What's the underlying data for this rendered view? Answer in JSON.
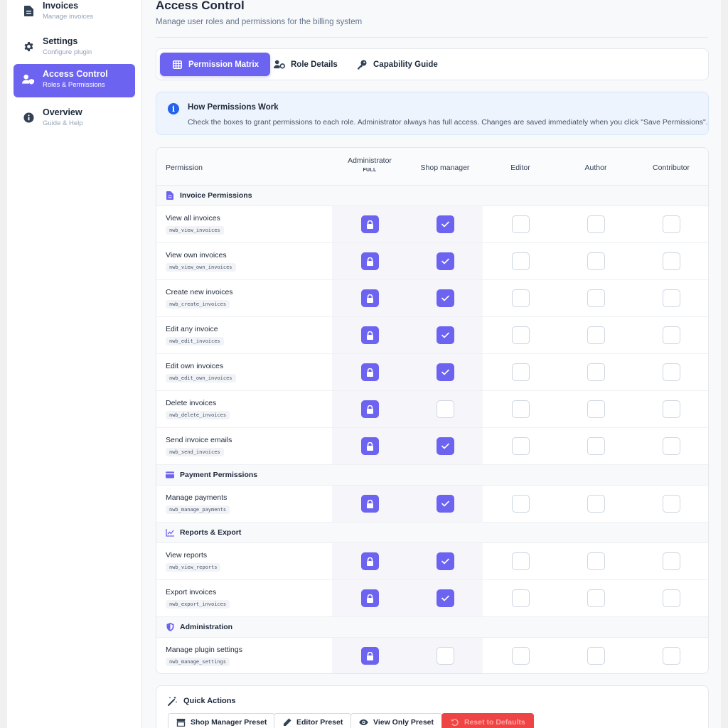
{
  "sidebar": {
    "items": [
      {
        "title": "Invoices",
        "sub": "Manage invoices",
        "icon": "document-icon"
      },
      {
        "title": "Settings",
        "sub": "Configure plugin",
        "icon": "gear-icon"
      },
      {
        "title": "Access Control",
        "sub": "Roles & Permissions",
        "icon": "user-shield-icon",
        "active": true
      },
      {
        "title": "Overview",
        "sub": "Guide & Help",
        "icon": "info-icon"
      }
    ]
  },
  "page": {
    "title": "Access Control",
    "subtitle": "Manage user roles and permissions for the billing system"
  },
  "tabs": [
    {
      "label": "Permission Matrix",
      "icon": "table-icon",
      "active": true
    },
    {
      "label": "Role Details",
      "icon": "user-gear-icon"
    },
    {
      "label": "Capability Guide",
      "icon": "key-icon"
    }
  ],
  "info": {
    "title": "How Permissions Work",
    "text": "Check the boxes to grant permissions to each role. Administrator always has full access. Changes are saved immediately when you click \"Save Permissions\"."
  },
  "matrix": {
    "permission_header": "Permission",
    "roles": [
      {
        "name": "Administrator",
        "tag": "FULL"
      },
      {
        "name": "Shop manager"
      },
      {
        "name": "Editor"
      },
      {
        "name": "Author"
      },
      {
        "name": "Contributor"
      }
    ],
    "sections": [
      {
        "label": "Invoice Permissions",
        "icon": "document-icon"
      },
      {
        "label": "Payment Permissions",
        "icon": "credit-card-icon"
      },
      {
        "label": "Reports & Export",
        "icon": "chart-line-icon"
      },
      {
        "label": "Administration",
        "icon": "shield-icon"
      }
    ],
    "rows": [
      {
        "name": "View all invoices",
        "code": "nwb_view_invoices",
        "states": [
          "locked",
          "checked",
          "unchecked",
          "unchecked",
          "unchecked"
        ]
      },
      {
        "name": "View own invoices",
        "code": "nwb_view_own_invoices",
        "states": [
          "locked",
          "checked",
          "unchecked",
          "unchecked",
          "unchecked"
        ]
      },
      {
        "name": "Create new invoices",
        "code": "nwb_create_invoices",
        "states": [
          "locked",
          "checked",
          "unchecked",
          "unchecked",
          "unchecked"
        ]
      },
      {
        "name": "Edit any invoice",
        "code": "nwb_edit_invoices",
        "states": [
          "locked",
          "checked",
          "unchecked",
          "unchecked",
          "unchecked"
        ]
      },
      {
        "name": "Edit own invoices",
        "code": "nwb_edit_own_invoices",
        "states": [
          "locked",
          "checked",
          "unchecked",
          "unchecked",
          "unchecked"
        ]
      },
      {
        "name": "Delete invoices",
        "code": "nwb_delete_invoices",
        "states": [
          "locked",
          "unchecked",
          "unchecked",
          "unchecked",
          "unchecked"
        ]
      },
      {
        "name": "Send invoice emails",
        "code": "nwb_send_invoices",
        "states": [
          "locked",
          "checked",
          "unchecked",
          "unchecked",
          "unchecked"
        ]
      },
      {
        "name": "Manage payments",
        "code": "nwb_manage_payments",
        "states": [
          "locked",
          "checked",
          "unchecked",
          "unchecked",
          "unchecked"
        ]
      },
      {
        "name": "View reports",
        "code": "nwb_view_reports",
        "states": [
          "locked",
          "checked",
          "unchecked",
          "unchecked",
          "unchecked"
        ]
      },
      {
        "name": "Export invoices",
        "code": "nwb_export_invoices",
        "states": [
          "locked",
          "checked",
          "unchecked",
          "unchecked",
          "unchecked"
        ]
      },
      {
        "name": "Manage plugin settings",
        "code": "nwb_manage_settings",
        "states": [
          "locked",
          "unchecked",
          "unchecked",
          "unchecked",
          "unchecked"
        ]
      }
    ]
  },
  "quick_actions": {
    "title": "Quick Actions",
    "buttons": [
      {
        "label": "Shop Manager Preset",
        "icon": "store-icon"
      },
      {
        "label": "Editor Preset",
        "icon": "pen-icon"
      },
      {
        "label": "View Only Preset",
        "icon": "eye-icon"
      },
      {
        "label": "Reset to Defaults",
        "icon": "undo-icon",
        "danger": true
      }
    ]
  },
  "colors": {
    "accent": "#6c63f0",
    "info_blue": "#2563eb",
    "danger": "#ef4444"
  }
}
